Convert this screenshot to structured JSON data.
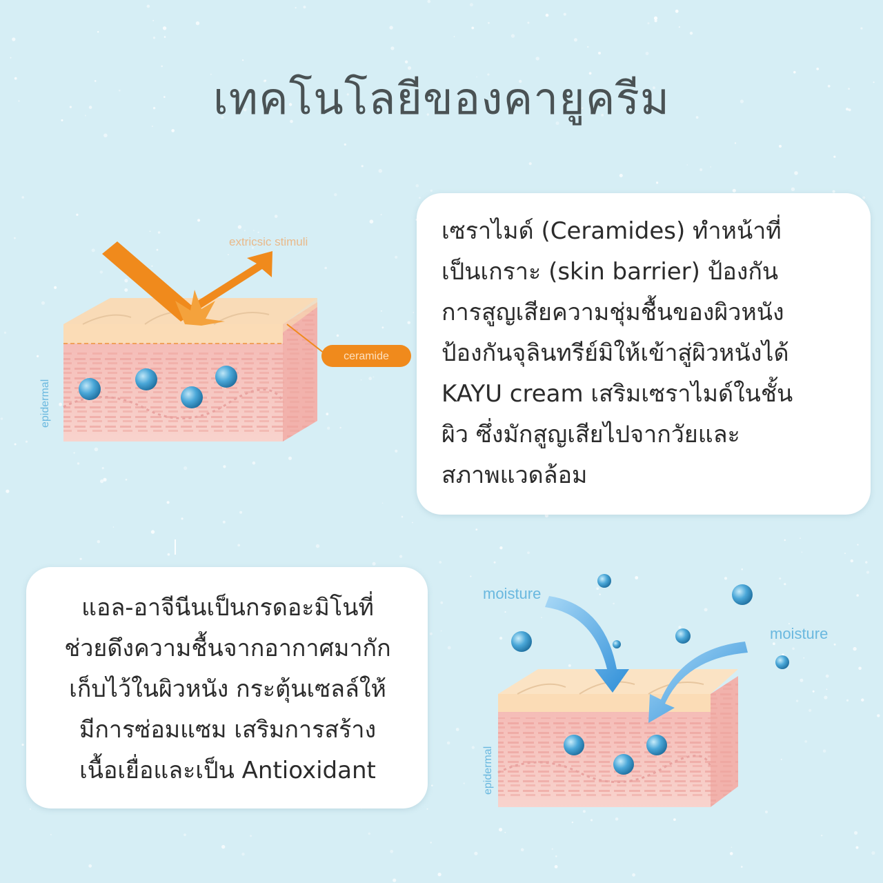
{
  "title": "เทคโนโลยีของคายูครีม",
  "ceramide_card": {
    "lines": [
      "เซราไมด์ (Ceramides) ทำหน้าที่",
      "เป็นเกราะ (skin barrier) ป้องกัน",
      "การสูญเสียความชุ่มชื้นของผิวหนัง",
      "ป้องกันจุลินทรีย์มิให้เข้าสู่ผิวหนังได้",
      "KAYU cream เสริมเซราไมด์ในชั้น",
      "ผิว ซึ่งมักสูญเสียไปจากวัยและ",
      "สภาพแวดล้อม"
    ]
  },
  "arginine_card": {
    "lines": [
      "แอล-อาจีนีนเป็นกรดอะมิโนที่",
      "ช่วยดึงความชื้นจากอากาศมากัก",
      "เก็บไว้ในผิวหนัง กระตุ้นเซลล์ให้",
      "มีการซ่อมแซม เสริมการสร้าง",
      "เนื้อเยื่อและเป็น Antioxidant"
    ]
  },
  "diagram_top": {
    "stimuli_label": "extricsic stimuli",
    "ceramide_label": "ceramide",
    "layer_label": "epidermal"
  },
  "diagram_bottom": {
    "moisture_label_left": "moisture",
    "moisture_label_right": "moisture",
    "layer_label": "epidermal"
  },
  "colors": {
    "background": "#d6eef5",
    "accent_orange": "#f08a1c",
    "moisture_blue": "#3a9ee0",
    "skin_pink": "#f6c9c3",
    "skin_top": "#fbe3c4",
    "label_blue": "#6ab8df"
  }
}
